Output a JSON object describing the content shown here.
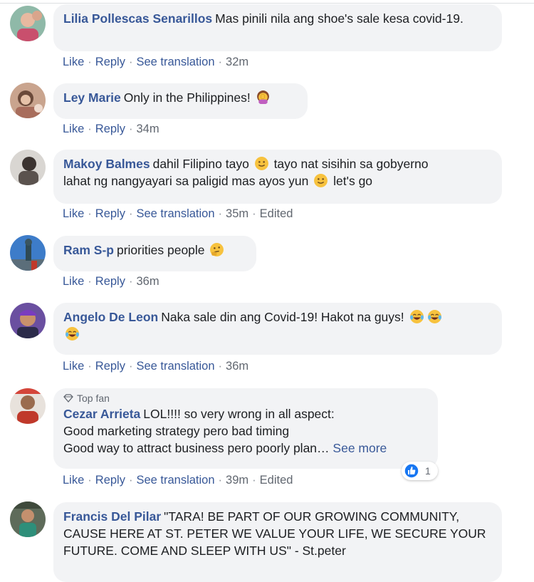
{
  "comments": [
    {
      "name": "Lilia Pollescas Senarillos",
      "text": "Mas pinili nila ang shoe's sale kesa covid-19.",
      "actions": [
        "Like",
        "Reply",
        "See translation"
      ],
      "time": "32m"
    },
    {
      "name": "Ley Marie",
      "text": "Only in the Philippines!",
      "emoji": "facepalm-woman-emoji",
      "actions": [
        "Like",
        "Reply"
      ],
      "time": "34m"
    },
    {
      "name": "Makoy Balmes",
      "text_parts": [
        "dahil Filipino tayo",
        "tayo nat sisihin sa gobyerno",
        "lahat ng nangyayari sa paligid mas ayos yun",
        "let's go"
      ],
      "emoji": "smile-emoji",
      "actions": [
        "Like",
        "Reply",
        "See translation"
      ],
      "time": "35m",
      "edited": "Edited"
    },
    {
      "name": "Ram S-p",
      "text": "priorities people",
      "emoji": "thinking-emoji",
      "actions": [
        "Like",
        "Reply"
      ],
      "time": "36m"
    },
    {
      "name": "Angelo De Leon",
      "text": "Naka sale din ang Covid-19! Hakot na guys!",
      "emoji": "tears-of-joy-emoji",
      "actions": [
        "Like",
        "Reply",
        "See translation"
      ],
      "time": "36m"
    },
    {
      "badge": "Top fan",
      "name": "Cezar Arrieta",
      "lines": [
        "LOL!!!! so very wrong in all aspect:",
        "Good marketing strategy pero bad timing",
        "Good way to attract business pero poorly plan…"
      ],
      "see_more": "See more",
      "reaction_count": "1",
      "actions": [
        "Like",
        "Reply",
        "See translation"
      ],
      "time": "39m",
      "edited": "Edited"
    },
    {
      "name": "Francis Del Pilar",
      "text": "\"TARA! BE PART OF OUR GROWING COMMUNITY, CAUSE HERE AT ST. PETER WE VALUE YOUR LIFE, WE SECURE YOUR FUTURE. COME AND SLEEP WITH US\" - St.peter"
    }
  ],
  "colors": {
    "name": "#385898",
    "bubble": "#f2f3f5",
    "meta": "#616770",
    "like_blue": "#1877f2"
  }
}
